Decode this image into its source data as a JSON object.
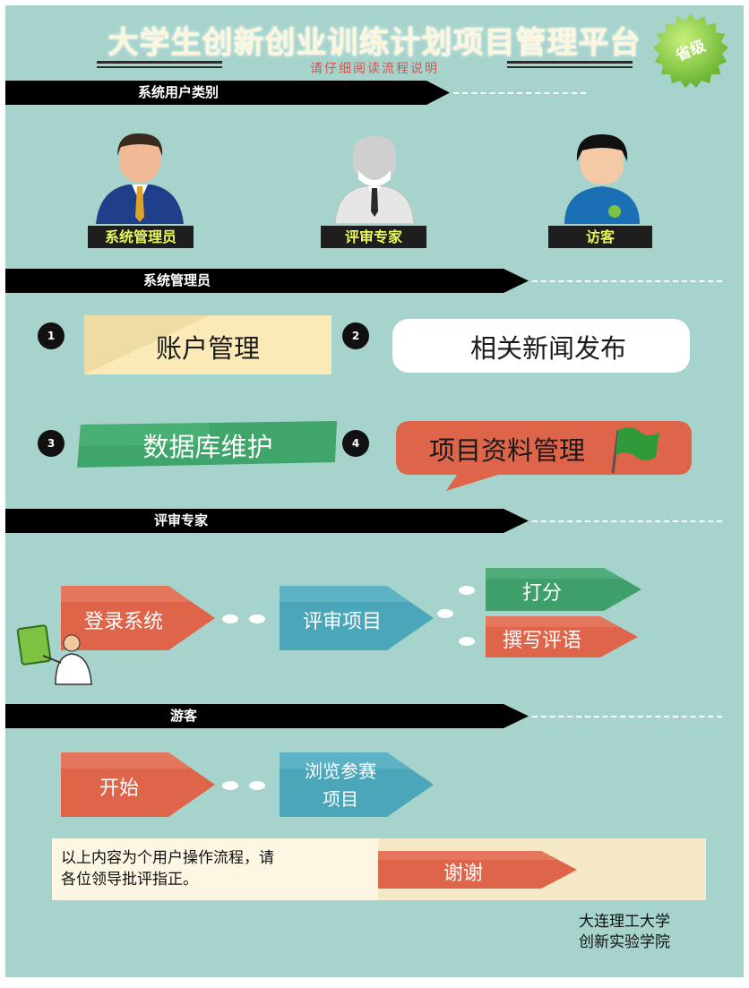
{
  "header": {
    "title": "大学生创新创业训练计划项目管理平台",
    "subtitle": "请仔细阅读流程说明",
    "seal_text": "省级"
  },
  "sections": {
    "user_types": "系统用户类别",
    "admin": "系统管理员",
    "expert": "评审专家",
    "visitor": "游客"
  },
  "roles": [
    "系统管理员",
    "评审专家",
    "访客"
  ],
  "admin_items": [
    {
      "num": "1",
      "label": "账户管理"
    },
    {
      "num": "2",
      "label": "相关新闻发布"
    },
    {
      "num": "3",
      "label": "数据库维护"
    },
    {
      "num": "4",
      "label": "项目资料管理"
    }
  ],
  "expert_flow": {
    "step1": "登录系统",
    "step2": "评审项目",
    "step3a": "打分",
    "step3b": "撰写评语"
  },
  "visitor_flow": {
    "step1": "开始",
    "step2_line1": "浏览参赛",
    "step2_line2": "项目"
  },
  "footer": {
    "note_line1": "以上内容为个用户操作流程，请",
    "note_line2": "各位领导批评指正。",
    "thanks": "谢谢",
    "school_line1": "大连理工大学",
    "school_line2": "创新实验学院"
  },
  "colors": {
    "background": "#a6d4cc",
    "orange": "#e0654a",
    "teal": "#4aa6b8",
    "green": "#3f9f6b",
    "band": "#000000",
    "role_label_text": "#e8f55a"
  }
}
